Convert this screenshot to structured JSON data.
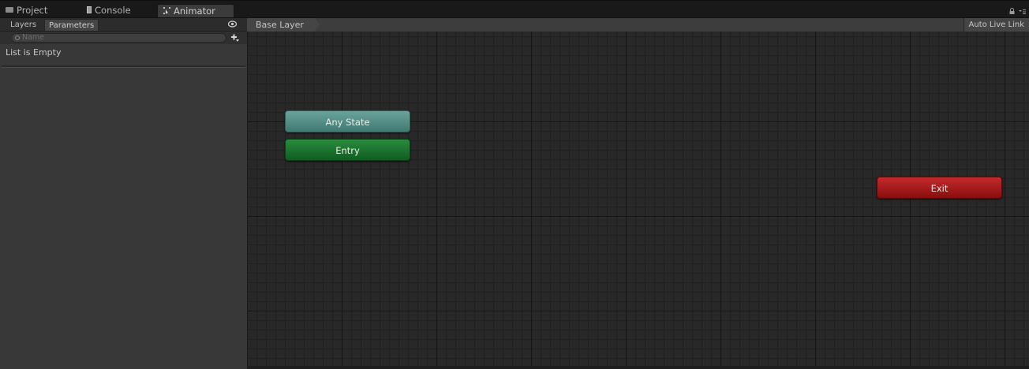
{
  "tabs": [
    {
      "label": "Project",
      "icon": "folder-icon"
    },
    {
      "label": "Console",
      "icon": "console-icon"
    },
    {
      "label": "Animator",
      "icon": "animator-icon",
      "active": true
    }
  ],
  "left_panel": {
    "subtabs": [
      {
        "label": "Layers"
      },
      {
        "label": "Parameters",
        "active": true
      }
    ],
    "search": {
      "placeholder": "Name",
      "value": ""
    },
    "empty_text": "List is Empty"
  },
  "graph": {
    "breadcrumb": "Base Layer",
    "live_link_label": "Auto Live Link",
    "states": {
      "any_state": {
        "label": "Any State",
        "color": "#5a958c"
      },
      "entry": {
        "label": "Entry",
        "color": "#1e7a31"
      },
      "exit": {
        "label": "Exit",
        "color": "#b01e1e"
      }
    }
  }
}
